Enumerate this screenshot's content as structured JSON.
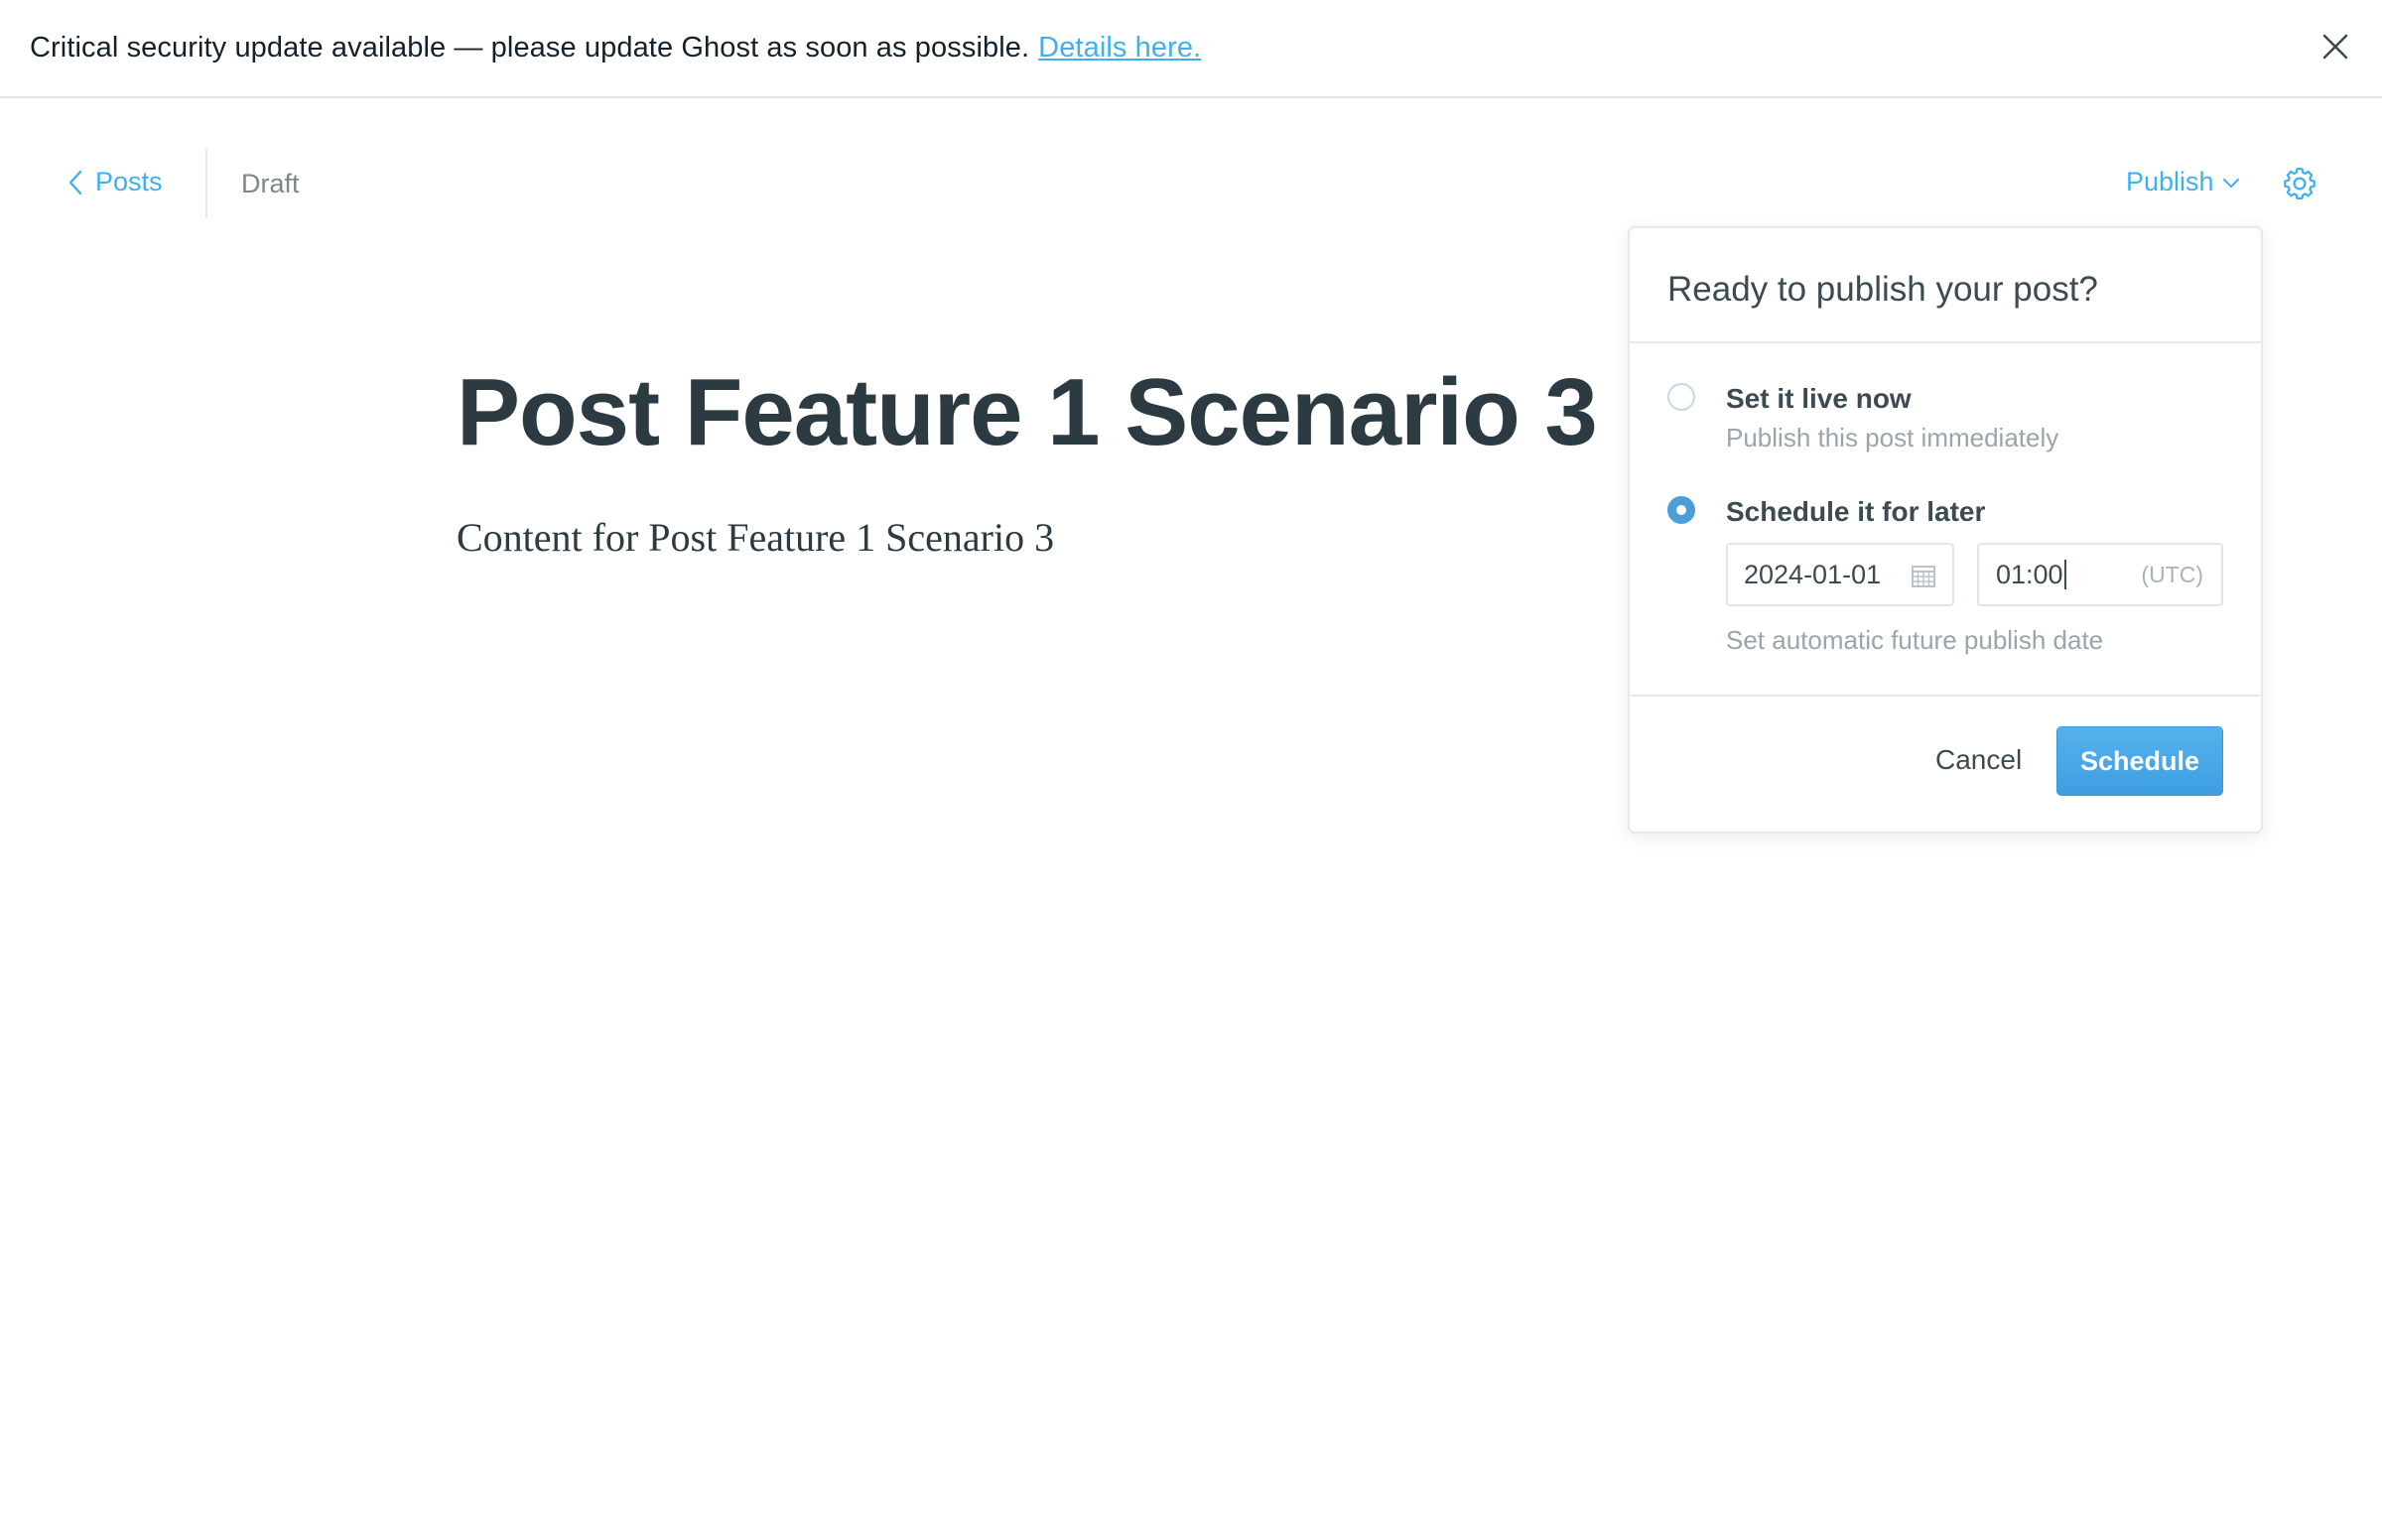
{
  "alert": {
    "message": "Critical security update available — please update Ghost as soon as possible.",
    "link_text": "Details here.",
    "close_icon": "close-icon"
  },
  "header": {
    "back_label": "Posts",
    "back_icon": "chevron-left-icon",
    "status": "Draft",
    "publish_label": "Publish",
    "publish_icon": "chevron-down-icon",
    "settings_icon": "gear-icon"
  },
  "post": {
    "title": "Post Feature 1 Scenario 3",
    "body": "Content for Post Feature 1 Scenario 3"
  },
  "publish_menu": {
    "title": "Ready to publish your post?",
    "options": [
      {
        "label": "Set it live now",
        "description": "Publish this post immediately",
        "selected": false
      },
      {
        "label": "Schedule it for later",
        "description": "Set automatic future publish date",
        "selected": true
      }
    ],
    "date_value": "2024-01-01",
    "date_icon": "calendar-icon",
    "time_value": "01:00",
    "timezone": "(UTC)",
    "cancel_label": "Cancel",
    "schedule_label": "Schedule"
  },
  "colors": {
    "accent": "#3eb0ef",
    "button": "#4a9fd9",
    "text": "#15212a",
    "muted": "#9aa5ab"
  }
}
